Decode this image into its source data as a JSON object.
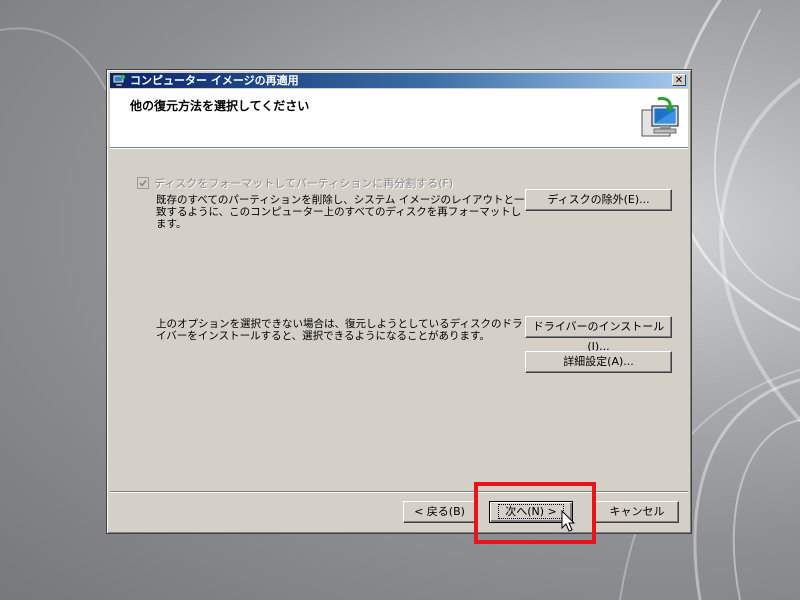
{
  "window": {
    "title": "コンピューター イメージの再適用",
    "close_symbol": "✕"
  },
  "header": {
    "title": "他の復元方法を選択してください",
    "icon": "restore-computer-icon"
  },
  "format_option": {
    "label": "ディスクをフォーマットしてパーティションに再分割する(F)",
    "checked": true,
    "enabled": false,
    "description": "既存のすべてのパーティションを削除し、システム イメージのレイアウトと一致するように、このコンピューター上のすべてのディスクを再フォーマットします。"
  },
  "buttons": {
    "exclude_disks": "ディスクの除外(E)...",
    "install_drivers": "ドライバーのインストール(I)...",
    "advanced": "詳細設定(A)...",
    "back": "< 戻る(B)",
    "next": "次へ(N) >",
    "cancel": "キャンセル"
  },
  "driver_note": "上のオプションを選択できない場合は、復元しようとしているディスクのドライバーをインストールすると、選択できるようになることがあります。",
  "colors": {
    "dialog_face": "#d4d0c8",
    "title_bar": "#0a246a",
    "highlight_box": "#e8141c"
  }
}
